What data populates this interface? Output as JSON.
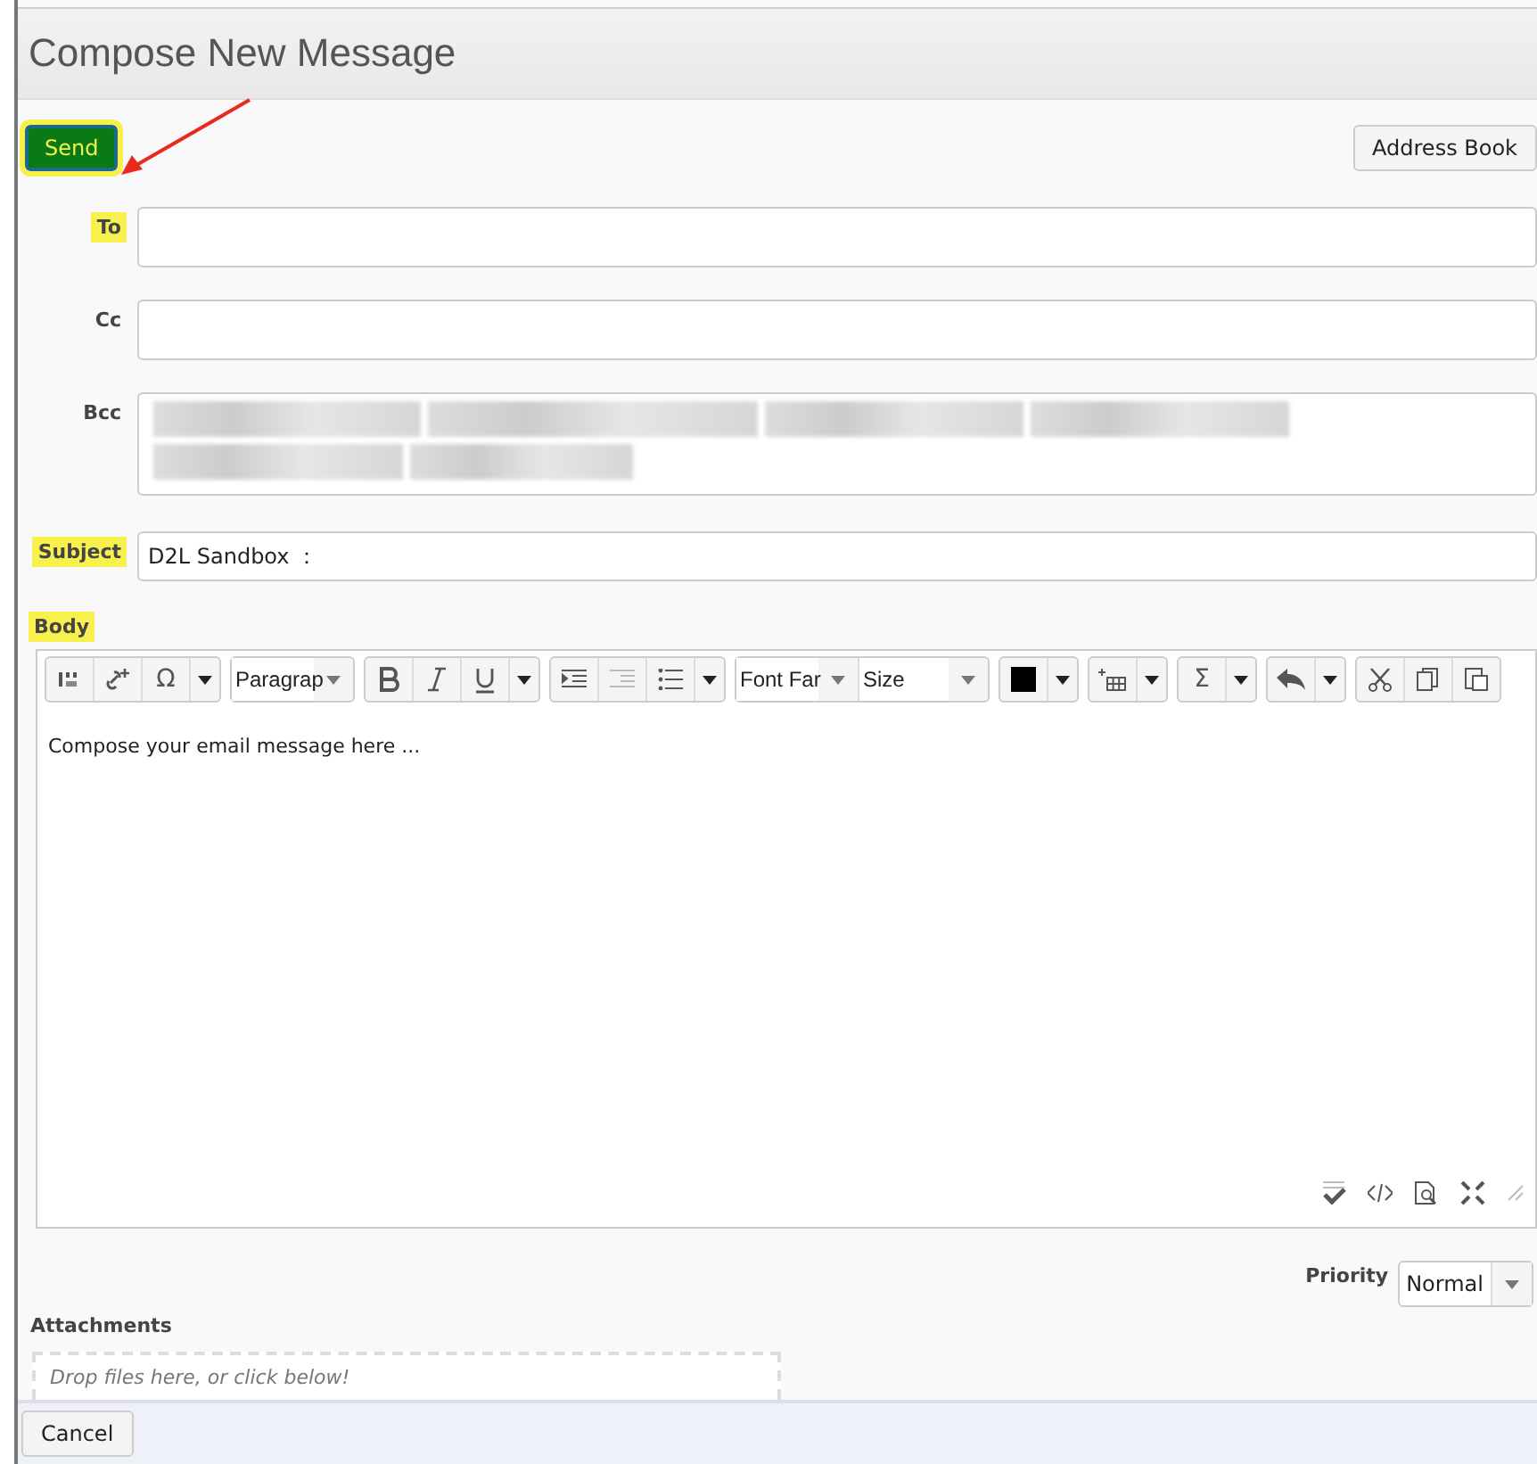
{
  "window": {
    "title": "Compose New Message"
  },
  "send_button": {
    "label": "Send",
    "highlighted": true
  },
  "address_book_button": {
    "label": "Address Book"
  },
  "fields": [
    {
      "label": "To",
      "highlighted": true,
      "kind": "line"
    },
    {
      "label": "Cc",
      "highlighted": false,
      "kind": "line"
    },
    {
      "label": "Bcc",
      "highlighted": false,
      "kind": "recipients"
    },
    {
      "label": "Subject",
      "highlighted": true,
      "value": "D2L Sandbox ：",
      "kind": "line"
    }
  ],
  "body": {
    "label": "Body",
    "highlighted": true,
    "placeholder": "Compose your email message here ...",
    "toolbar": {
      "special_char": "Ω",
      "paragraph": "Paragrap",
      "font_family": "Font Far",
      "size": "Size",
      "equation": "Σ"
    }
  },
  "priority": {
    "label": "Priority",
    "value": "Normal"
  },
  "attachments": {
    "label": "Attachments",
    "drop_hint": "Drop files here, or click below!"
  },
  "cancel_button": {
    "label": "Cancel"
  }
}
